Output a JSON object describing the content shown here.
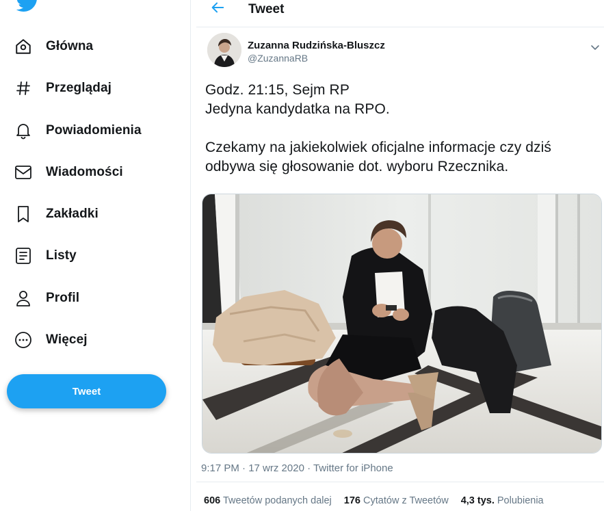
{
  "sidebar": {
    "items": [
      {
        "label": "Główna",
        "icon": "home-icon"
      },
      {
        "label": "Przeglądaj",
        "icon": "hashtag-icon"
      },
      {
        "label": "Powiadomienia",
        "icon": "bell-icon"
      },
      {
        "label": "Wiadomości",
        "icon": "envelope-icon"
      },
      {
        "label": "Zakładki",
        "icon": "bookmark-icon"
      },
      {
        "label": "Listy",
        "icon": "list-icon"
      },
      {
        "label": "Profil",
        "icon": "person-icon"
      },
      {
        "label": "Więcej",
        "icon": "more-circle-icon"
      }
    ],
    "tweet_button": "Tweet"
  },
  "header": {
    "title": "Tweet"
  },
  "tweet": {
    "author_name": "Zuzanna Rudzińska-Bluszcz",
    "author_handle": "@ZuzannaRB",
    "text": "Godz. 21:15, Sejm RP\nJedyna kandydatka na RPO.\n\nCzekamy na jakiekolwiek oficjalne informacje czy dziś odbywa się głosowanie dot. wyboru Rzecznika.",
    "meta": "9:17 PM · 17 wrz 2020 · Twitter for iPhone",
    "stats": [
      {
        "count": "606",
        "label": "Tweetów podanych dalej"
      },
      {
        "count": "176",
        "label": "Cytatów z Tweetów"
      },
      {
        "count": "4,3 tys.",
        "label": "Polubienia"
      }
    ]
  },
  "colors": {
    "accent": "#1da1f2",
    "text": "#14171a",
    "muted": "#657786",
    "border": "#e6ecf0"
  }
}
